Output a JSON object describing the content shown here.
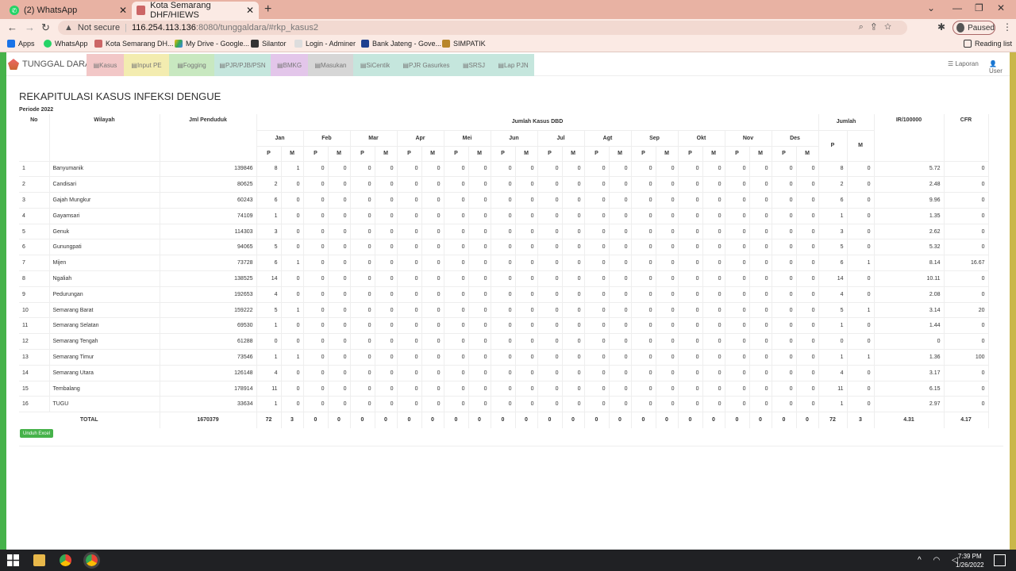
{
  "browser": {
    "tabs": [
      {
        "title": "(2) WhatsApp",
        "icon": "whatsapp-icon"
      },
      {
        "title": "Kota Semarang DHF/HIEWS",
        "icon": "app-logo-icon"
      }
    ],
    "address": {
      "security": "Not secure",
      "host": "116.254.113.136",
      "path": ":8080/tunggaldara/#rkp_kasus2"
    },
    "profile": "Paused",
    "bookmarks": [
      "Apps",
      "WhatsApp",
      "Kota Semarang DH...",
      "My Drive - Google...",
      "Silantor",
      "Login - Adminer",
      "Bank Jateng - Gove...",
      "SIMPATIK"
    ],
    "reading_list": "Reading list"
  },
  "app": {
    "brand": "TUNGGAL DARA",
    "menu": [
      {
        "label": "Kasus",
        "color": "#f2c7c7"
      },
      {
        "label": "Input PE",
        "color": "#f3ecb0"
      },
      {
        "label": "Fogging",
        "color": "#c8e8c0"
      },
      {
        "label": "PJR/PJB/PSN",
        "color": "#c5e6dd"
      },
      {
        "label": "BMKG",
        "color": "#e3c6ea"
      },
      {
        "label": "Masukan",
        "color": "#d6d6d6"
      },
      {
        "label": "SiCentik",
        "color": "#c5e6dd"
      },
      {
        "label": "PJR Gasurkes",
        "color": "#c5e6dd"
      },
      {
        "label": "SRSJ",
        "color": "#c5e6dd"
      },
      {
        "label": "Lap PJN",
        "color": "#c5e6dd"
      }
    ],
    "right_menu": [
      "Laporan",
      "User"
    ]
  },
  "report": {
    "title": "REKAPITULASI KASUS INFEKSI DENGUE",
    "periode": "Periode 2022",
    "headers": {
      "no": "No",
      "wilayah": "Wilayah",
      "penduduk": "Jml Penduduk",
      "jumlah_kasus": "Jumlah Kasus DBD",
      "jumlah": "Jumlah",
      "ir": "IR/100000",
      "cfr": "CFR",
      "p": "P",
      "m": "M"
    },
    "months": [
      "Jan",
      "Feb",
      "Mar",
      "Apr",
      "Mei",
      "Jun",
      "Jul",
      "Agt",
      "Sep",
      "Okt",
      "Nov",
      "Des"
    ],
    "rows": [
      {
        "no": "1",
        "wilayah": "Banyumanik",
        "penduduk": "139846",
        "jan_p": "8",
        "jan_m": "1",
        "total_p": "8",
        "total_m": "0",
        "ir": "5.72",
        "cfr": "0"
      },
      {
        "no": "2",
        "wilayah": "Candisari",
        "penduduk": "80625",
        "jan_p": "2",
        "jan_m": "0",
        "total_p": "2",
        "total_m": "0",
        "ir": "2.48",
        "cfr": "0"
      },
      {
        "no": "3",
        "wilayah": "Gajah Mungkur",
        "penduduk": "60243",
        "jan_p": "6",
        "jan_m": "0",
        "total_p": "6",
        "total_m": "0",
        "ir": "9.96",
        "cfr": "0"
      },
      {
        "no": "4",
        "wilayah": "Gayamsari",
        "penduduk": "74109",
        "jan_p": "1",
        "jan_m": "0",
        "total_p": "1",
        "total_m": "0",
        "ir": "1.35",
        "cfr": "0"
      },
      {
        "no": "5",
        "wilayah": "Genuk",
        "penduduk": "114303",
        "jan_p": "3",
        "jan_m": "0",
        "total_p": "3",
        "total_m": "0",
        "ir": "2.62",
        "cfr": "0"
      },
      {
        "no": "6",
        "wilayah": "Gunungpati",
        "penduduk": "94065",
        "jan_p": "5",
        "jan_m": "0",
        "total_p": "5",
        "total_m": "0",
        "ir": "5.32",
        "cfr": "0"
      },
      {
        "no": "7",
        "wilayah": "Mijen",
        "penduduk": "73728",
        "jan_p": "6",
        "jan_m": "1",
        "total_p": "6",
        "total_m": "1",
        "ir": "8.14",
        "cfr": "16.67"
      },
      {
        "no": "8",
        "wilayah": "Ngaliah",
        "penduduk": "138525",
        "jan_p": "14",
        "jan_m": "0",
        "total_p": "14",
        "total_m": "0",
        "ir": "10.11",
        "cfr": "0"
      },
      {
        "no": "9",
        "wilayah": "Pedurungan",
        "penduduk": "192653",
        "jan_p": "4",
        "jan_m": "0",
        "total_p": "4",
        "total_m": "0",
        "ir": "2.08",
        "cfr": "0"
      },
      {
        "no": "10",
        "wilayah": "Semarang Barat",
        "penduduk": "159222",
        "jan_p": "5",
        "jan_m": "1",
        "total_p": "5",
        "total_m": "1",
        "ir": "3.14",
        "cfr": "20"
      },
      {
        "no": "11",
        "wilayah": "Semarang Selatan",
        "penduduk": "69530",
        "jan_p": "1",
        "jan_m": "0",
        "total_p": "1",
        "total_m": "0",
        "ir": "1.44",
        "cfr": "0"
      },
      {
        "no": "12",
        "wilayah": "Semarang Tengah",
        "penduduk": "61288",
        "jan_p": "0",
        "jan_m": "0",
        "total_p": "0",
        "total_m": "0",
        "ir": "0",
        "cfr": "0"
      },
      {
        "no": "13",
        "wilayah": "Semarang Timur",
        "penduduk": "73546",
        "jan_p": "1",
        "jan_m": "1",
        "total_p": "1",
        "total_m": "1",
        "ir": "1.36",
        "cfr": "100"
      },
      {
        "no": "14",
        "wilayah": "Semarang Utara",
        "penduduk": "126148",
        "jan_p": "4",
        "jan_m": "0",
        "total_p": "4",
        "total_m": "0",
        "ir": "3.17",
        "cfr": "0"
      },
      {
        "no": "15",
        "wilayah": "Tembalang",
        "penduduk": "178914",
        "jan_p": "11",
        "jan_m": "0",
        "total_p": "11",
        "total_m": "0",
        "ir": "6.15",
        "cfr": "0"
      },
      {
        "no": "16",
        "wilayah": "TUGU",
        "penduduk": "33634",
        "jan_p": "1",
        "jan_m": "0",
        "total_p": "1",
        "total_m": "0",
        "ir": "2.97",
        "cfr": "0"
      }
    ],
    "total": {
      "label": "TOTAL",
      "penduduk": "1670379",
      "jan_p": "72",
      "jan_m": "3",
      "total_p": "72",
      "total_m": "3",
      "ir": "4.31",
      "cfr": "4.17"
    },
    "zero": "0",
    "export_button": "Unduh Excel"
  },
  "taskbar": {
    "time": "7:39 PM",
    "date": "1/26/2022"
  }
}
